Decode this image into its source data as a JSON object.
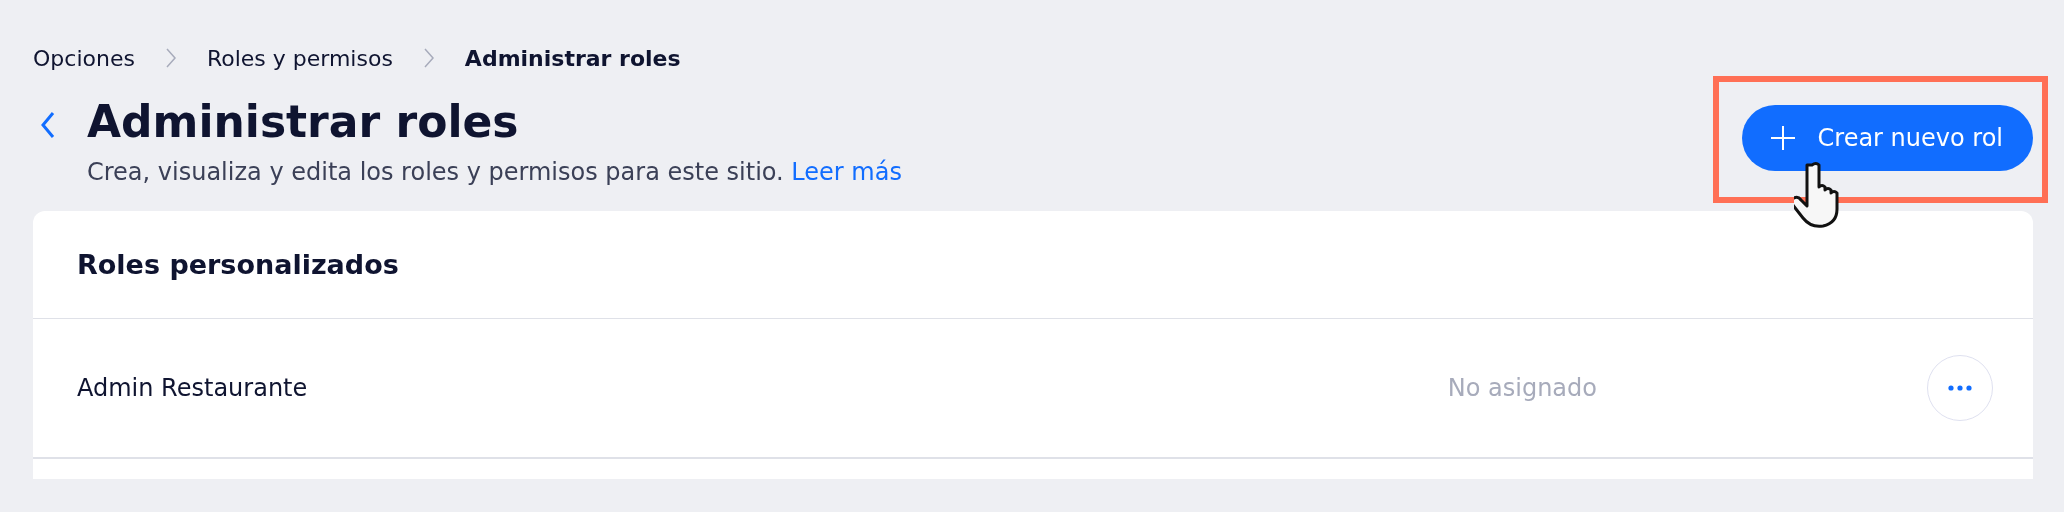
{
  "breadcrumbs": [
    {
      "label": "Opciones",
      "current": false
    },
    {
      "label": "Roles y permisos",
      "current": false
    },
    {
      "label": "Administrar roles",
      "current": true
    }
  ],
  "header": {
    "title": "Administrar roles",
    "subtitle": "Crea, visualiza y edita los roles y permisos para este sitio.",
    "link": "Leer más"
  },
  "create_button": {
    "label": "Crear nuevo rol",
    "highlighted": true
  },
  "roles_card": {
    "title": "Roles personalizados",
    "rows": [
      {
        "name": "Admin Restaurante",
        "status": "No asignado"
      }
    ]
  }
}
